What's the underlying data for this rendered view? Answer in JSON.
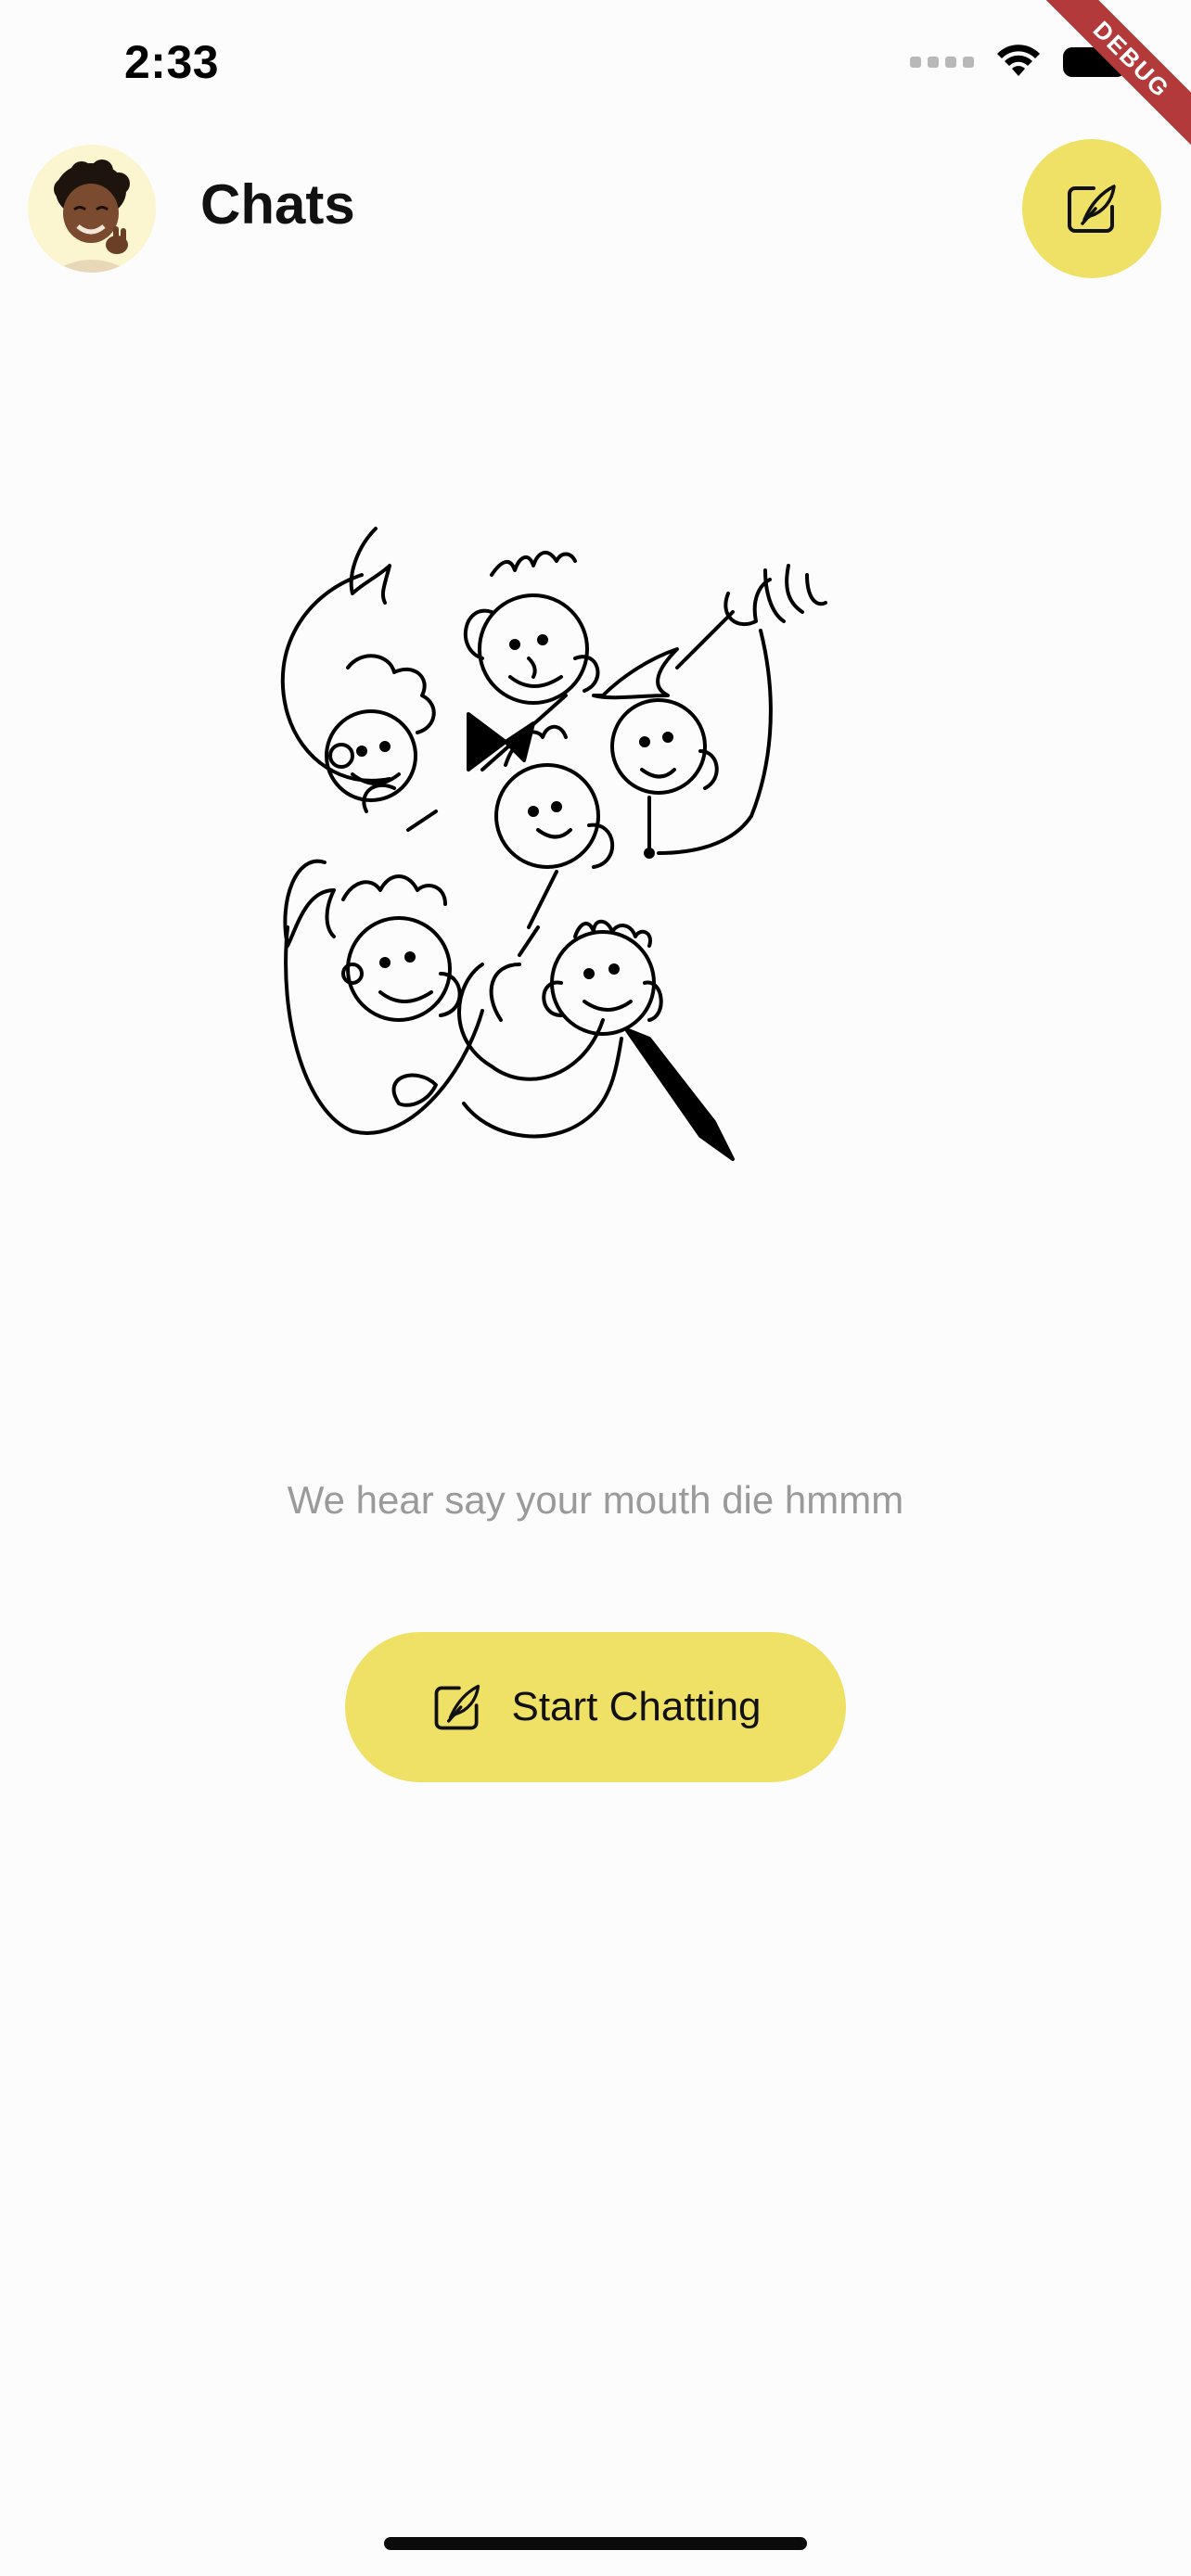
{
  "status_bar": {
    "time": "2:33"
  },
  "debug_banner": {
    "label": "DEBUG"
  },
  "header": {
    "title": "Chats",
    "avatar_icon": "memoji-avatar",
    "compose_icon": "compose-quill-icon"
  },
  "empty_state": {
    "illustration": "people-doodle-illustration",
    "message": "We hear say your mouth die hmmm",
    "button_label": "Start Chatting",
    "button_icon": "compose-quill-icon"
  },
  "colors": {
    "accent": "#efe066",
    "avatar_bg": "#fbf5d0",
    "background": "#fcfcfc",
    "muted_text": "#9a9a9a"
  }
}
